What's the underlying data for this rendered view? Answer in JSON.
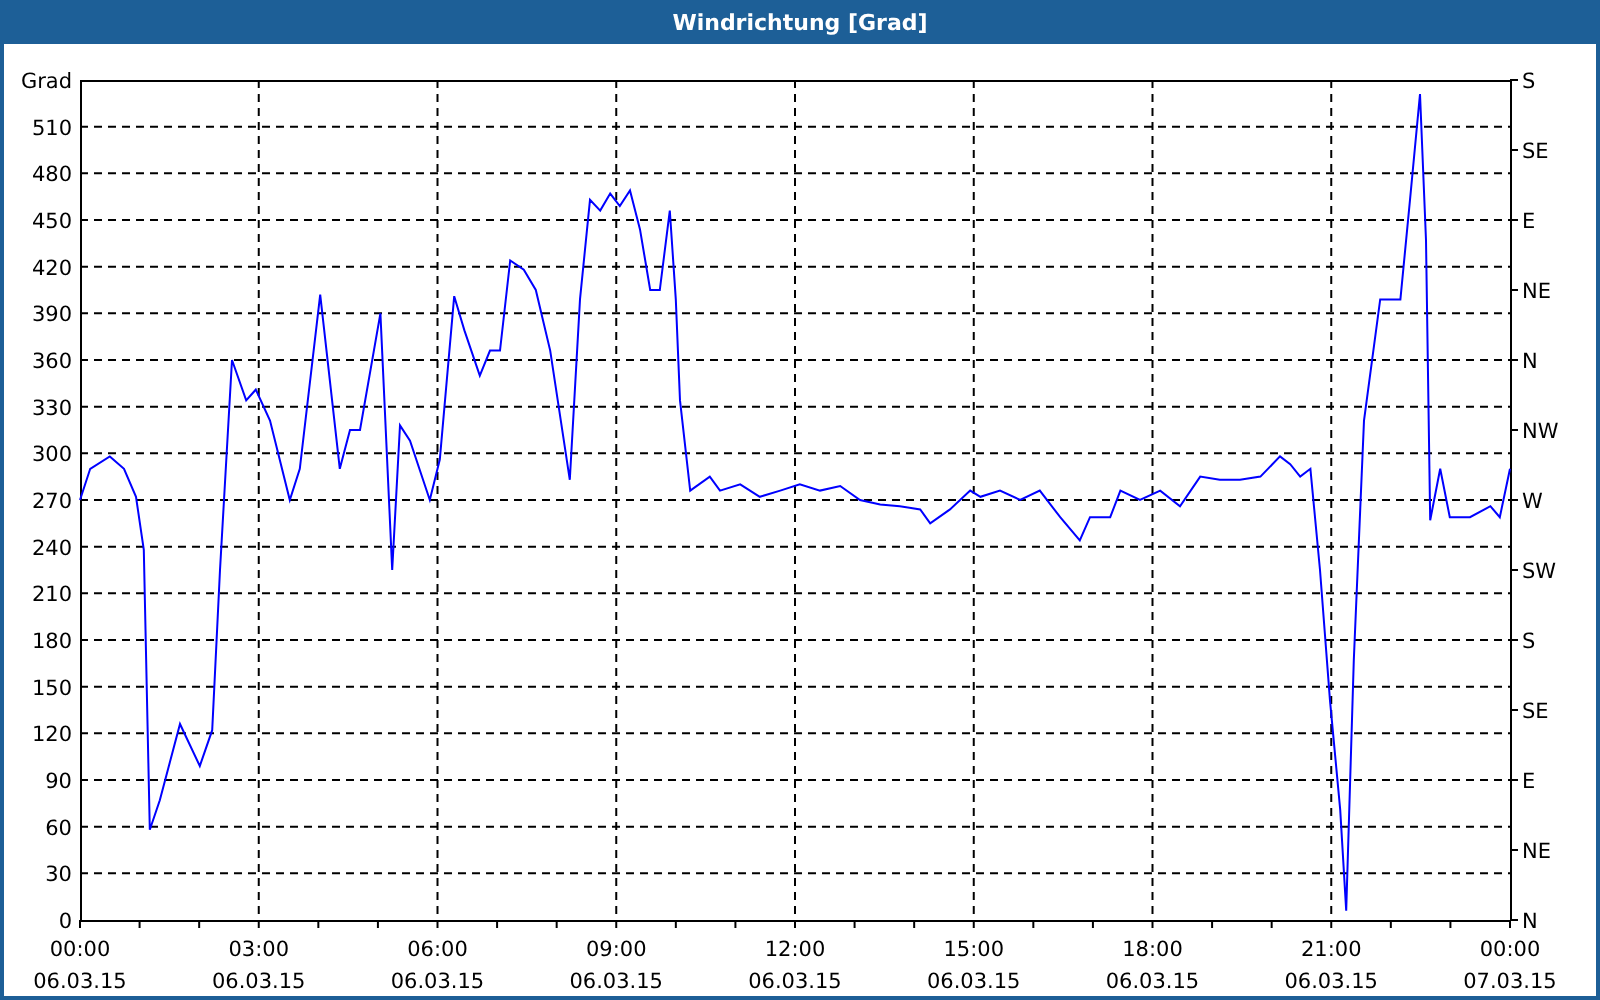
{
  "window": {
    "title": "Windrichtung [Grad]"
  },
  "chart": {
    "chart_data": {
      "type": "line",
      "grid": true,
      "ylabel": "Grad",
      "xlim": [
        0,
        24
      ],
      "ylim": [
        0,
        540
      ],
      "xticks": [
        {
          "value": 0,
          "label": "00:00"
        },
        {
          "value": 3,
          "label": "03:00"
        },
        {
          "value": 6,
          "label": "06:00"
        },
        {
          "value": 9,
          "label": "09:00"
        },
        {
          "value": 12,
          "label": "12:00"
        },
        {
          "value": 15,
          "label": "15:00"
        },
        {
          "value": 18,
          "label": "18:00"
        },
        {
          "value": 21,
          "label": "21:00"
        },
        {
          "value": 24,
          "label": "00:00"
        }
      ],
      "yticks": [
        {
          "value": 510,
          "label": "510"
        },
        {
          "value": 480,
          "label": "480"
        },
        {
          "value": 450,
          "label": "450"
        },
        {
          "value": 420,
          "label": "420"
        },
        {
          "value": 390,
          "label": "390"
        },
        {
          "value": 360,
          "label": "360"
        },
        {
          "value": 330,
          "label": "330"
        },
        {
          "value": 300,
          "label": "300"
        },
        {
          "value": 270,
          "label": "270"
        },
        {
          "value": 240,
          "label": "240"
        },
        {
          "value": 210,
          "label": "210"
        },
        {
          "value": 180,
          "label": "180"
        },
        {
          "value": 150,
          "label": "150"
        },
        {
          "value": 120,
          "label": "120"
        },
        {
          "value": 90,
          "label": "90"
        },
        {
          "value": 60,
          "label": "60"
        },
        {
          "value": 30,
          "label": "30"
        },
        {
          "value": 0,
          "label": "0"
        }
      ],
      "x": [
        0,
        0.17,
        0.5,
        0.74,
        0.94,
        1.07,
        1.17,
        1.34,
        1.68,
        2.01,
        2.22,
        2.35,
        2.55,
        2.79,
        2.95,
        3.19,
        3.52,
        3.69,
        4.03,
        4.36,
        4.53,
        4.7,
        5.04,
        5.24,
        5.37,
        5.54,
        5.87,
        6.04,
        6.28,
        6.45,
        6.71,
        6.88,
        7.05,
        7.22,
        7.45,
        7.65,
        7.89,
        8.22,
        8.39,
        8.56,
        8.73,
        8.9,
        9.06,
        9.23,
        9.4,
        9.57,
        9.73,
        9.9,
        10,
        10.07,
        10.24,
        10.57,
        10.74,
        11.08,
        11.41,
        11.75,
        12.08,
        12.42,
        12.76,
        13.09,
        13.43,
        13.76,
        14.1,
        14.27,
        14.6,
        14.94,
        15.11,
        15.44,
        15.78,
        16.11,
        16.45,
        16.78,
        16.95,
        17.29,
        17.46,
        17.79,
        18.13,
        18.46,
        18.8,
        19.13,
        19.47,
        19.81,
        20.14,
        20.31,
        20.48,
        20.65,
        20.81,
        20.98,
        21.15,
        21.25,
        21.38,
        21.55,
        21.82,
        22.16,
        22.32,
        22.49,
        22.59,
        22.66,
        22.83,
        22.99,
        23.33,
        23.67,
        23.83,
        24
      ],
      "series": [
        {
          "color": "#0000ff",
          "values": [
            270,
            290,
            298,
            290,
            272,
            238,
            58,
            77,
            126,
            99,
            122,
            225,
            360,
            334,
            341,
            321,
            270,
            290,
            402,
            290,
            315,
            315,
            390,
            225,
            318,
            308,
            270,
            296,
            401,
            379,
            350,
            366,
            366,
            424,
            418,
            405,
            366,
            283,
            399,
            463,
            456,
            467,
            459,
            469,
            444,
            405,
            405,
            456,
            399,
            334,
            276,
            285,
            276,
            280,
            272,
            276,
            280,
            276,
            279,
            270,
            267,
            266,
            264,
            255,
            264,
            276,
            272,
            276,
            270,
            276,
            259,
            244,
            259,
            259,
            276,
            270,
            276,
            266,
            285,
            283,
            283,
            285,
            298,
            293,
            285,
            290,
            225,
            141,
            71,
            6,
            167,
            321,
            399,
            399,
            463,
            531,
            437,
            257,
            290,
            259,
            259,
            266,
            259,
            290
          ]
        }
      ]
    },
    "x_dates": [
      "06.03.15",
      "06.03.15",
      "06.03.15",
      "06.03.15",
      "06.03.15",
      "06.03.15",
      "06.03.15",
      "06.03.15",
      "07.03.15"
    ],
    "right_axis_labels": [
      "S",
      "SE",
      "E",
      "NE",
      "N",
      "NW",
      "W",
      "SW",
      "S",
      "SE",
      "E",
      "NE",
      "N"
    ]
  }
}
